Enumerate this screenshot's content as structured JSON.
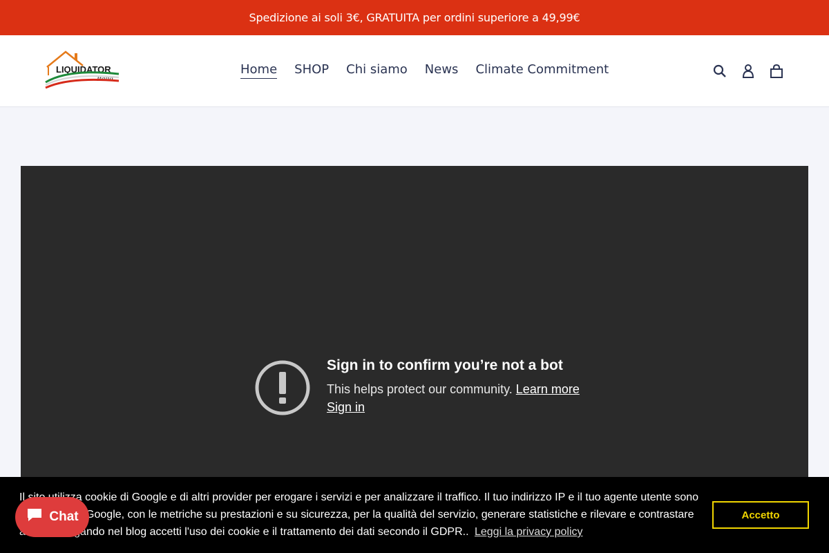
{
  "announcement": "Spedizione ai soli 3€, GRATUITA per ordini superiore a 49,99€",
  "logo": {
    "brand": "LIQUIDATOR",
    "sub": "Italia"
  },
  "nav": [
    {
      "label": "Home",
      "active": true
    },
    {
      "label": "SHOP",
      "active": false
    },
    {
      "label": "Chi siamo",
      "active": false
    },
    {
      "label": "News",
      "active": false
    },
    {
      "label": "Climate Commitment",
      "active": false
    }
  ],
  "header_icons": [
    "search-icon",
    "account-icon",
    "cart-icon"
  ],
  "video": {
    "title": "Sign in to confirm you’re not a bot",
    "message": "This helps protect our community.",
    "learn_more": "Learn more",
    "sign_in": "Sign in"
  },
  "cookie": {
    "text": "Il sito utilizza cookie di Google e di altri provider per erogare i servizi e per analizzare il traffico. Il tuo indirizzo IP e il tuo agente utente sono condivisi con Google, con le metriche su prestazioni e su sicurezza, per la qualità del servizio, generare statistiche e rilevare e contrastare abusi. Navigando nel blog accetti l'uso dei cookie e il trattamento dei dati secondo il GDPR..",
    "privacy_link": "Leggi la privacy policy",
    "accept": "Accetto"
  },
  "chat": {
    "label": "Chat"
  },
  "colors": {
    "announce_bg": "#db3113",
    "accept_border": "#f1d600",
    "chat_bg": "#de3c3c"
  }
}
